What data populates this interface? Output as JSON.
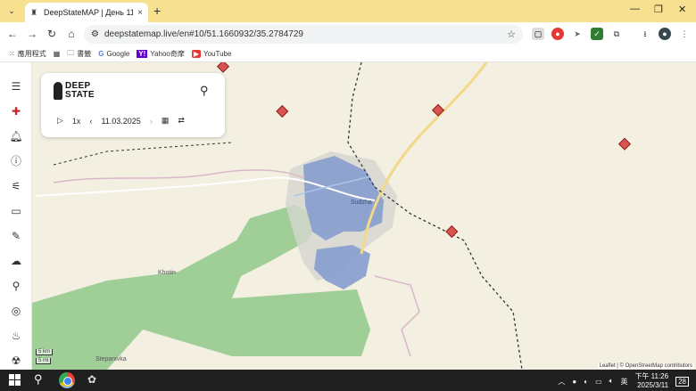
{
  "browser": {
    "tab_title": "DeepStateMAP | День 1112 | Ка...",
    "tab_close": "×",
    "new_tab": "+",
    "url": "deepstatemap.live/en#10/51.1660932/35.2784729",
    "bookmarks": [
      {
        "label": "應用程式",
        "icon": "apps-icon"
      },
      {
        "label": "",
        "icon": "grid-icon"
      },
      {
        "label": "書籤",
        "icon": "folder-icon"
      },
      {
        "label": "Google",
        "icon": "google-icon"
      },
      {
        "label": "Yahoo奇摩",
        "icon": "yahoo-icon"
      },
      {
        "label": "YouTube",
        "icon": "youtube-icon"
      }
    ]
  },
  "app": {
    "logo_line1": "DEEP",
    "logo_line2": "STATE",
    "speed": "1x",
    "date": "11.03.2025"
  },
  "map": {
    "labels": {
      "sudzha": "Sudzha",
      "khotin": "Khotin",
      "stepanivka": "Stepanivka"
    },
    "scale_km": "5 km",
    "scale_mi": "5 mi",
    "attribution": "Leaflet | © OpenStreetMap contributors",
    "colors": {
      "occupied_blue": "#8aa0cf",
      "green_zone": "#8fc98a",
      "diamond_red": "#d9534f"
    }
  },
  "taskbar": {
    "time": "下午 11:26",
    "date": "2025/3/11",
    "ime": "英",
    "notification_count": "28"
  }
}
